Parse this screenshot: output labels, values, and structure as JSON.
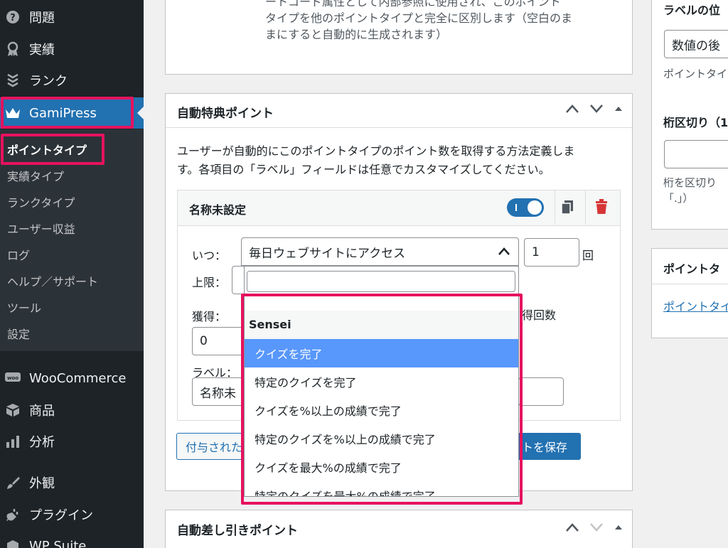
{
  "sidebar": {
    "items": [
      {
        "label": "問題",
        "icon": "question-circle-icon"
      },
      {
        "label": "実績",
        "icon": "award-icon"
      },
      {
        "label": "ランク",
        "icon": "rank-icon"
      },
      {
        "label": "GamiPress",
        "icon": "crown-icon"
      },
      {
        "label": "WooCommerce",
        "icon": "woo-icon"
      },
      {
        "label": "商品",
        "icon": "box-icon"
      },
      {
        "label": "分析",
        "icon": "chart-bar-icon"
      },
      {
        "label": "外観",
        "icon": "paintbrush-icon"
      },
      {
        "label": "プラグイン",
        "icon": "plug-icon"
      },
      {
        "label": "WP Suite",
        "icon": "suite-icon"
      }
    ],
    "submenu": [
      "ポイントタイプ",
      "実績タイプ",
      "ランクタイプ",
      "ユーザー収益",
      "ログ",
      "ヘルプ／サポート",
      "ツール",
      "設定"
    ]
  },
  "top_panel": {
    "text_line1": "ートコード属性として内部参照に使用され、このポイント",
    "text_line2": "タイプを他のポイントタイプと完全に区別します（空白のま",
    "text_line3": "まにすると自動的に生成されます）"
  },
  "award_panel": {
    "title": "自動特典ポイント",
    "desc_line1": "ユーザーが自動的にこのポイントタイプのポイント数を取得する方法定義しま",
    "desc_line2": "す。各項目の「ラベル」フィールドは任意でカスタマイズしてください。",
    "requirement": {
      "name": "名称未設定",
      "when_label": "いつ：",
      "when_value": "毎日ウェブサイトにアクセス",
      "count_value": "1",
      "count_unit": "回",
      "limit_label": "上限：",
      "earn_label": "獲得：",
      "earn_value": "0",
      "earn_times_suffix": "得回数",
      "label_label": "ラベル：",
      "label_value": "名称未"
    },
    "btn_left": "付与された",
    "btn_save": "トを保存"
  },
  "dropdown": {
    "search_value": "",
    "group": "Sensei",
    "options": [
      "クイズを完了",
      "特定のクイズを完了",
      "クイズを%以上の成績で完了",
      "特定のクイズを%以上の成績で完了",
      "クイズを最大%の成績で完了",
      "特定のクイズを最大%の成績で完了"
    ]
  },
  "deduct_panel": {
    "title": "自動差し引きポイント"
  },
  "right_col": {
    "label_position_title": "ラベルの位",
    "label_position_value": "数値の後",
    "label_position_help": "ポイントタイ",
    "separator_title": "桁区切り（1",
    "separator_help1": "桁を区切り",
    "separator_help2": "「.」）",
    "box2_title": "ポイントタ",
    "box2_link": "ポイントタイ"
  },
  "colors": {
    "accent": "#2271b1",
    "highlight": "#e6125e",
    "option_selected": "#5897fb",
    "delete": "#d63638"
  }
}
